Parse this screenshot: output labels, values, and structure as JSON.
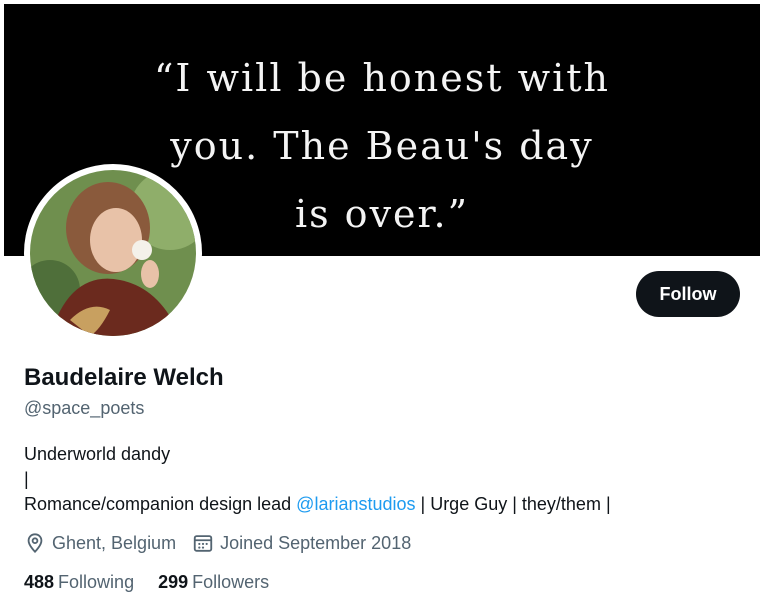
{
  "banner": {
    "quote": "“I will be honest with\nyou.  The Beau's day\nis over.”"
  },
  "profile": {
    "name": "Baudelaire Welch",
    "handle": "@space_poets",
    "follow_label": "Follow",
    "bio": {
      "line1": "Underworld dandy",
      "line2": "|",
      "line3_prefix": "Romance/companion design lead ",
      "mention": "@larianstudios",
      "line3_suffix": " | Urge Guy | they/them |"
    },
    "location": "Ghent, Belgium",
    "joined": "Joined September 2018",
    "following_count": "488",
    "following_label": "Following",
    "followers_count": "299",
    "followers_label": "Followers"
  },
  "icons": {
    "location": "location-pin-icon",
    "calendar": "calendar-icon"
  },
  "colors": {
    "text_primary": "#0f1419",
    "text_secondary": "#536471",
    "link": "#1d9bf0",
    "button_bg": "#0f1419",
    "banner_bg": "#000000"
  }
}
